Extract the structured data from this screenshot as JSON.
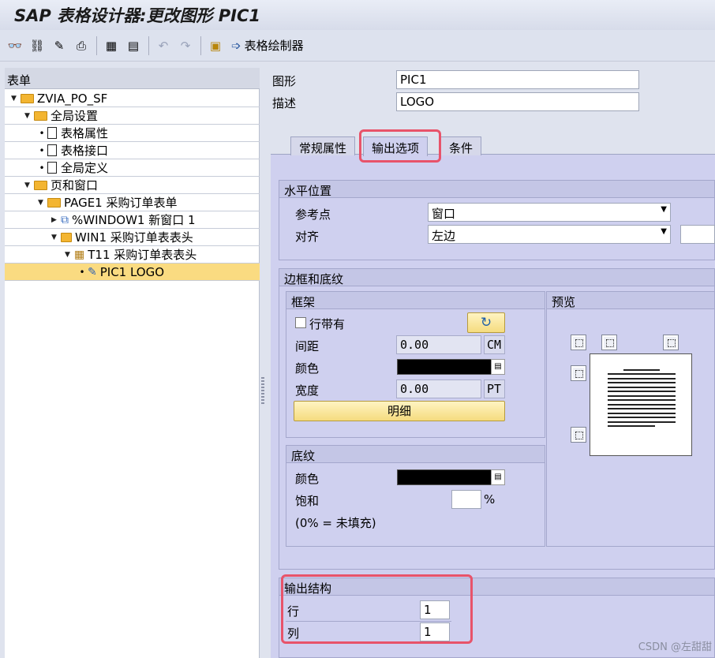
{
  "title": "SAP 表格设计器:更改图形 PIC1",
  "toolbar": {
    "icons": [
      "glasses-icon",
      "hierarchy-icon",
      "magic-wand-icon",
      "print-icon",
      "layout-icon",
      "form-icon",
      "undo-icon",
      "redo-icon",
      "form-painter-icon",
      "arrow-right-icon"
    ],
    "painter_label": "表格绘制器"
  },
  "tree": {
    "header": "表单",
    "items": [
      {
        "label": "ZVIA_PO_SF",
        "indent": 0,
        "kind": "folder",
        "expander": "open"
      },
      {
        "label": "全局设置",
        "indent": 1,
        "kind": "folder",
        "expander": "open"
      },
      {
        "label": "表格属性",
        "indent": 2,
        "kind": "doc",
        "expander": "dot"
      },
      {
        "label": "表格接口",
        "indent": 2,
        "kind": "doc",
        "expander": "dot"
      },
      {
        "label": "全局定义",
        "indent": 2,
        "kind": "doc",
        "expander": "dot"
      },
      {
        "label": "页和窗口",
        "indent": 1,
        "kind": "folder",
        "expander": "open"
      },
      {
        "label": "PAGE1 采购订单表单",
        "indent": 2,
        "kind": "folder",
        "expander": "open"
      },
      {
        "label": "%WINDOW1 新窗口 1",
        "indent": 3,
        "kind": "window",
        "expander": "closed"
      },
      {
        "label": "WIN1 采购订单表表头",
        "indent": 3,
        "kind": "folder-small",
        "expander": "open"
      },
      {
        "label": "T11 采购订单表表头",
        "indent": 4,
        "kind": "table",
        "expander": "open"
      },
      {
        "label": "PIC1 LOGO",
        "indent": 5,
        "kind": "graphic",
        "expander": "dot",
        "selected": true
      }
    ]
  },
  "header_fields": {
    "graphic_label": "图形",
    "graphic_value": "PIC1",
    "desc_label": "描述",
    "desc_value": "LOGO"
  },
  "tabs": [
    {
      "label": "常规属性",
      "active": false
    },
    {
      "label": "输出选项",
      "active": true
    },
    {
      "label": "条件",
      "active": false
    }
  ],
  "horizontal": {
    "title": "水平位置",
    "ref_label": "参考点",
    "ref_value": "窗口",
    "align_label": "对齐",
    "align_value": "左边"
  },
  "border": {
    "title": "边框和底纹",
    "frame_title": "框架",
    "with_line_label": "行带有",
    "with_line_checked": false,
    "spacing_label": "间距",
    "spacing_value": "0.00",
    "spacing_unit": "CM",
    "color_label": "颜色",
    "width_label": "宽度",
    "width_value": "0.00",
    "width_unit": "PT",
    "detail_button": "明细",
    "preview_title": "预览",
    "shading_title": "底纹",
    "shading_color_label": "颜色",
    "saturation_label": "饱和",
    "saturation_value": "",
    "saturation_unit": "%",
    "shading_note": "(0% = 未填充)",
    "frame_color": "#000000",
    "shading_color": "#000000"
  },
  "output_struct": {
    "title": "输出结构",
    "row_label": "行",
    "row_value": "1",
    "col_label": "列",
    "col_value": "1"
  },
  "watermark": "CSDN @左甜甜",
  "colors": {
    "selected_row": "#fadb81",
    "tab_panel": "#cfd0ef",
    "highlight": "#e8536a"
  }
}
